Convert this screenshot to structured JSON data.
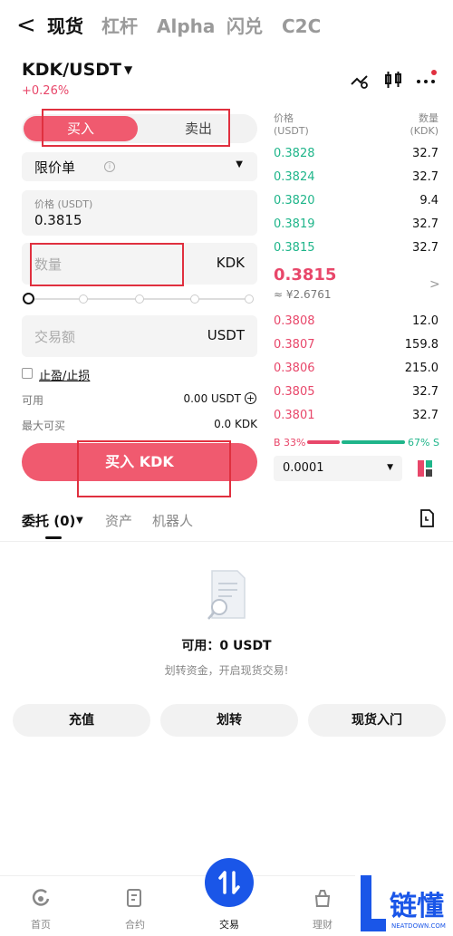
{
  "nav": {
    "back": "<",
    "tabs": [
      "现货",
      "杠杆",
      "Alpha",
      "闪兑",
      "C2C"
    ]
  },
  "pair": {
    "name": "KDK/USDT",
    "change": "+0.26%"
  },
  "trade_form": {
    "buy_label": "买入",
    "sell_label": "卖出",
    "order_type": "限价单",
    "price_label": "价格 (USDT)",
    "price_value": "0.3815",
    "qty_placeholder": "数量",
    "qty_unit": "KDK",
    "amount_placeholder": "交易额",
    "amount_unit": "USDT",
    "tpsl_label": "止盈/止损",
    "available_label": "可用",
    "available_value": "0.00 USDT",
    "max_buy_label": "最大可买",
    "max_buy_value": "0.0 KDK",
    "buy_button": "买入 KDK"
  },
  "orderbook": {
    "price_header": "价格\n(USDT)",
    "qty_header": "数量\n(KDK)",
    "asks": [
      {
        "price": "0.3828",
        "qty": "32.7"
      },
      {
        "price": "0.3824",
        "qty": "32.7"
      },
      {
        "price": "0.3820",
        "qty": "9.4"
      },
      {
        "price": "0.3819",
        "qty": "32.7"
      },
      {
        "price": "0.3815",
        "qty": "32.7"
      }
    ],
    "last_price": "0.3815",
    "last_fiat": "≈ ¥2.6761",
    "bids": [
      {
        "price": "0.3808",
        "qty": "12.0"
      },
      {
        "price": "0.3807",
        "qty": "159.8"
      },
      {
        "price": "0.3806",
        "qty": "215.0"
      },
      {
        "price": "0.3805",
        "qty": "32.7"
      },
      {
        "price": "0.3801",
        "qty": "32.7"
      }
    ],
    "buy_ratio": "B 33%",
    "sell_ratio": "67% S",
    "precision": "0.0001"
  },
  "orders": {
    "tabs": [
      "委托 (0)",
      "资产",
      "机器人"
    ],
    "available": "可用：0 USDT",
    "hint": "划转资金，开启现货交易!",
    "buttons": [
      "充值",
      "划转",
      "现货入门"
    ]
  },
  "bottom_nav": [
    "首页",
    "合约",
    "交易",
    "理财"
  ],
  "colors": {
    "buy": "#f05a6f",
    "ask_green": "#1fb58a",
    "bid_red": "#e8476a",
    "trade_blue": "#1a56e8"
  }
}
